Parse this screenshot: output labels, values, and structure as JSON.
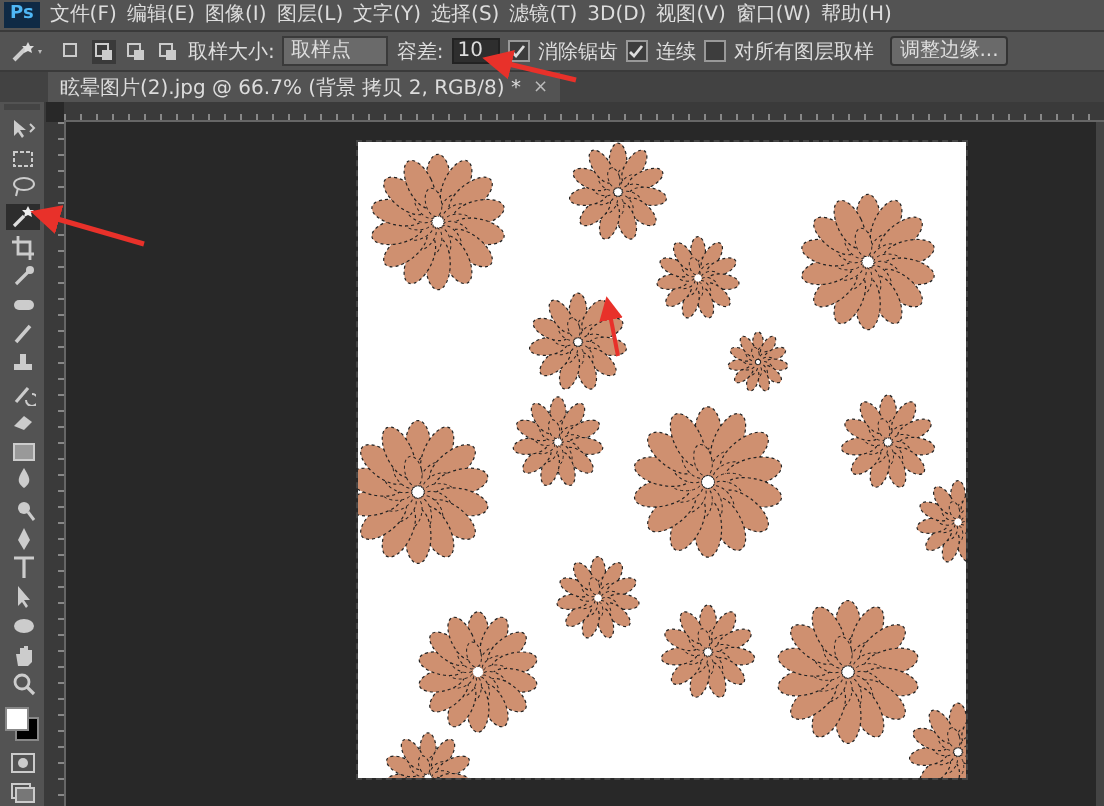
{
  "app": {
    "logo": "Ps"
  },
  "menu": [
    "文件(F)",
    "编辑(E)",
    "图像(I)",
    "图层(L)",
    "文字(Y)",
    "选择(S)",
    "滤镜(T)",
    "3D(D)",
    "视图(V)",
    "窗口(W)",
    "帮助(H)"
  ],
  "options": {
    "sample_label": "取样大小:",
    "sample_value": "取样点",
    "tolerance_label": "容差:",
    "tolerance_value": "10",
    "checkboxes": [
      {
        "label": "消除锯齿",
        "checked": true
      },
      {
        "label": "连续",
        "checked": true
      },
      {
        "label": "对所有图层取样",
        "checked": false
      }
    ],
    "button": "调整边缘..."
  },
  "tab": {
    "title": "眩晕图片(2).jpg @ 66.7% (背景 拷贝 2, RGB/8) *",
    "close": "×"
  },
  "tools": [
    {
      "kind": "move",
      "selected": false
    },
    {
      "kind": "marquee",
      "selected": false
    },
    {
      "kind": "lasso",
      "selected": false
    },
    {
      "kind": "wand",
      "selected": true
    },
    {
      "kind": "crop",
      "selected": false
    },
    {
      "kind": "eyedropper",
      "selected": false
    },
    {
      "kind": "heal",
      "selected": false
    },
    {
      "kind": "brush",
      "selected": false
    },
    {
      "kind": "stamp",
      "selected": false
    },
    {
      "kind": "history",
      "selected": false
    },
    {
      "kind": "eraser",
      "selected": false
    },
    {
      "kind": "gradient",
      "selected": false
    },
    {
      "kind": "blur",
      "selected": false
    },
    {
      "kind": "dodge",
      "selected": false
    },
    {
      "kind": "pen",
      "selected": false
    },
    {
      "kind": "type",
      "selected": false
    },
    {
      "kind": "path",
      "selected": false
    },
    {
      "kind": "shape",
      "selected": false
    },
    {
      "kind": "hand",
      "selected": false
    },
    {
      "kind": "zoom",
      "selected": false
    }
  ]
}
